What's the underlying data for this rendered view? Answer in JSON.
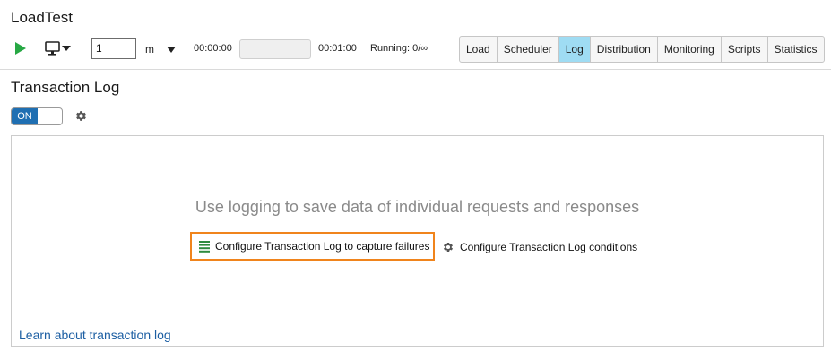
{
  "app": {
    "title": "LoadTest"
  },
  "toolbar": {
    "play_icon": "play-icon",
    "monitor_icon": "monitor-icon",
    "count_value": "1",
    "unit_value": "m",
    "time_start": "00:00:00",
    "progress_fraction": 0,
    "time_end": "00:01:00",
    "running": "Running: 0/∞"
  },
  "tabs": [
    {
      "label": "Load",
      "active": false
    },
    {
      "label": "Scheduler",
      "active": false
    },
    {
      "label": "Log",
      "active": true
    },
    {
      "label": "Distribution",
      "active": false
    },
    {
      "label": "Monitoring",
      "active": false
    },
    {
      "label": "Scripts",
      "active": false
    },
    {
      "label": "Statistics",
      "active": false
    }
  ],
  "section": {
    "title": "Transaction Log",
    "toggle_label": "ON",
    "toggle_on": true
  },
  "panel": {
    "message": "Use logging to save data of individual requests and responses",
    "configure_failures_label": "Configure Transaction Log to capture failures",
    "configure_conditions_label": "Configure Transaction Log conditions",
    "learn_link": "Learn about transaction log"
  },
  "colors": {
    "accent_tab": "#9fdcf3",
    "toggle_on": "#1f6fb2",
    "highlight_border": "#f0841c",
    "link": "#1d5fa3",
    "play": "#27a844",
    "list_icon": "#2e8b3e"
  }
}
